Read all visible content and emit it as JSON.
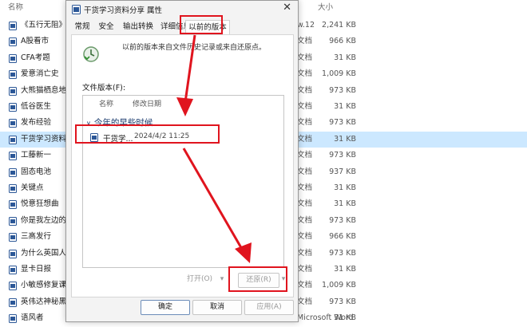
{
  "explorer": {
    "headers": {
      "name": "名称",
      "size": "大小"
    },
    "rows": [
      {
        "name": "《五行无阻》.PDF",
        "type": "w.12",
        "size": "2,241 KB"
      },
      {
        "name": "A股看市",
        "type": "文档",
        "size": "966 KB"
      },
      {
        "name": "CFA考题",
        "type": "文档",
        "size": "31 KB"
      },
      {
        "name": "爱意消亡史",
        "type": "文档",
        "size": "1,009 KB"
      },
      {
        "name": "大熊猫栖息地",
        "type": "文档",
        "size": "973 KB"
      },
      {
        "name": "低谷医生",
        "type": "文档",
        "size": "31 KB"
      },
      {
        "name": "发布经验",
        "type": "文档",
        "size": "973 KB"
      },
      {
        "name": "干货学习资料分",
        "type": "文档",
        "size": "31 KB",
        "selected": true
      },
      {
        "name": "工藤新一",
        "type": "文档",
        "size": "973 KB"
      },
      {
        "name": "固态电池",
        "type": "文档",
        "size": "937 KB"
      },
      {
        "name": "关键点",
        "type": "文档",
        "size": "31 KB"
      },
      {
        "name": "悦意狂想曲",
        "type": "文档",
        "size": "31 KB"
      },
      {
        "name": "你是我左边的风",
        "type": "文档",
        "size": "973 KB"
      },
      {
        "name": "三高发行",
        "type": "文档",
        "size": "966 KB"
      },
      {
        "name": "为什么英国人下",
        "type": "文档",
        "size": "973 KB"
      },
      {
        "name": "显卡日报",
        "type": "文档",
        "size": "31 KB"
      },
      {
        "name": "小敏感修复课",
        "type": "文档",
        "size": "1,009 KB"
      },
      {
        "name": "英伟达神秘黑科",
        "type": "文档",
        "size": "973 KB"
      },
      {
        "name": "语风者",
        "type": "Microsoft Word",
        "size": "31 KB"
      }
    ]
  },
  "dialog": {
    "title": "干货学习资料分享 属性",
    "close": "✕",
    "tabs": [
      "常规",
      "安全",
      "输出转换",
      "详细信息",
      "以前的版本"
    ],
    "active_tab": 4,
    "description": "以前的版本来自文件历史记录或来自还原点。",
    "file_versions_label": "文件版本(F):",
    "columns": {
      "name": "名称",
      "date": "修改日期"
    },
    "group_header": "今年的早些时候",
    "group_chevron": "∨",
    "item": {
      "name": "干货学...",
      "date": "2024/4/2 11:25"
    },
    "buttons": {
      "open": "打开(O)",
      "open_arrow": "▾",
      "restore": "还原(R)",
      "restore_arrow": "▾",
      "ok": "确定",
      "cancel": "取消",
      "apply": "应用(A)"
    }
  },
  "colors": {
    "accent": "#e0141e",
    "selection": "#cce8ff",
    "doc_icon": "#2b5797"
  }
}
